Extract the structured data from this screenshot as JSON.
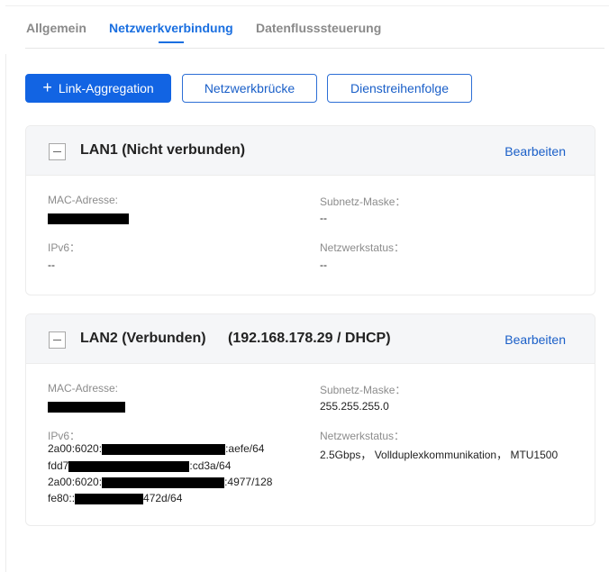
{
  "tabs": [
    {
      "label": "Allgemein",
      "active": false
    },
    {
      "label": "Netzwerkverbindung",
      "active": true
    },
    {
      "label": "Datenflusssteuerung",
      "active": false
    }
  ],
  "toolbar": {
    "link_aggregation": "Link-Aggregation",
    "bridge": "Netzwerkbrücke",
    "service_order": "Dienstreihenfolge"
  },
  "lan1": {
    "title": "LAN1 (Nicht verbunden)",
    "edit": "Bearbeiten",
    "mac_label": "MAC-Adresse:",
    "subnet_label": "Subnetz-Maske：",
    "subnet_value": "--",
    "ipv6_label": "IPv6：",
    "ipv6_value": "--",
    "status_label": "Netzwerkstatus：",
    "status_value": "--"
  },
  "lan2": {
    "title": "LAN2 (Verbunden)",
    "ip": "(192.168.178.29 / DHCP)",
    "edit": "Bearbeiten",
    "mac_label": "MAC-Adresse:",
    "subnet_label": "Subnetz-Maske：",
    "subnet_value": "255.255.255.0",
    "ipv6_label": "IPv6：",
    "ipv6": [
      {
        "prefix": "2a00:6020:",
        "suffix": ":aefe/64"
      },
      {
        "prefix": "fdd7",
        "suffix": ":cd3a/64"
      },
      {
        "prefix": "2a00:6020:",
        "suffix": ":4977/128"
      },
      {
        "prefix": "fe80::",
        "suffix": "472d/64"
      }
    ],
    "status_label": "Netzwerkstatus：",
    "status_value": "2.5Gbps， Vollduplexkommunikation， MTU1500"
  },
  "colors": {
    "accent": "#1264e3",
    "link": "#1a5fc8",
    "header_bg": "#f5f6f8"
  }
}
